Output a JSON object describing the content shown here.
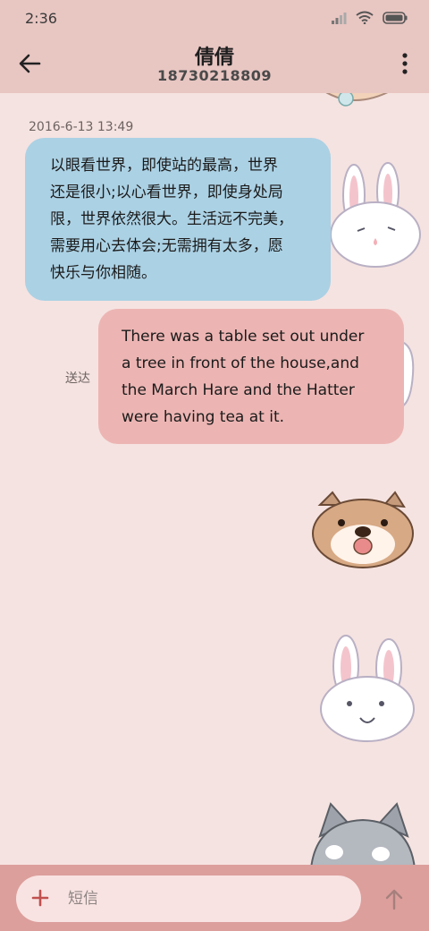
{
  "status_bar": {
    "time": "2:36"
  },
  "header": {
    "contact_name": "倩倩",
    "phone": "18730218809"
  },
  "messages": [
    {
      "direction": "incoming",
      "timestamp": "2016-6-13 13:49",
      "lines": [
        "以眼看世界，即使站的最高，世界",
        "还是很小;以心看世界，即使身处局",
        "限，世界依然很大。生活远不完美，",
        "需要用心去体会;无需拥有太多，愿",
        "快乐与你相随。"
      ]
    },
    {
      "direction": "outgoing",
      "status": "送达",
      "lines": [
        "There was a table set out under",
        "a tree in front of the house,and",
        "the March Hare and the Hatter",
        "were having tea at it."
      ]
    }
  ],
  "composer": {
    "placeholder": "短信"
  },
  "colors": {
    "header_bg": "#e8c6c2",
    "page_bg": "#f5e3e1",
    "incoming_bubble": "#abd1e4",
    "outgoing_bubble": "#ecb5b3",
    "bottom_bar": "#dc9f9c"
  },
  "icons": [
    "signal-icon",
    "wifi-icon",
    "battery-icon",
    "back-arrow-icon",
    "more-icon",
    "plus-icon",
    "send-arrow-icon"
  ]
}
